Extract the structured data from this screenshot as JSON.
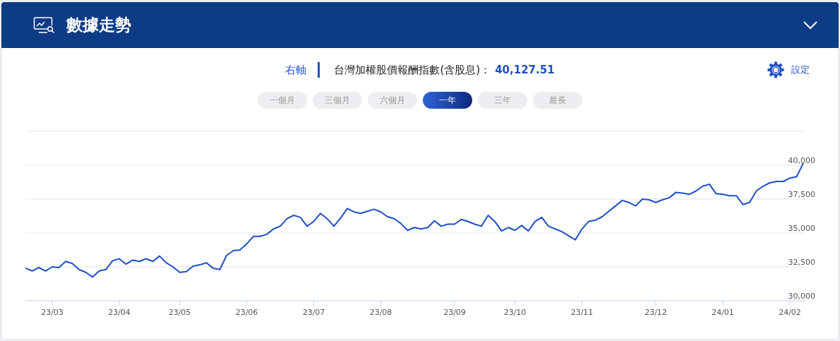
{
  "header": {
    "title": "數據走勢"
  },
  "info": {
    "axis_label": "右軸",
    "index_label": "台灣加權股價報酬指數(含股息)：",
    "index_value": "40,127.51",
    "settings_label": "設定"
  },
  "ranges": [
    {
      "label": "一個月",
      "selected": false
    },
    {
      "label": "三個月",
      "selected": false
    },
    {
      "label": "六個月",
      "selected": false
    },
    {
      "label": "一年",
      "selected": true
    },
    {
      "label": "三年",
      "selected": false
    },
    {
      "label": "最長",
      "selected": false
    }
  ],
  "chart": {
    "chart_data": {
      "type": "line",
      "grid": true,
      "ylim": [
        30000,
        42500
      ],
      "categories": [
        null,
        null,
        null,
        null,
        "23/03",
        null,
        null,
        null,
        null,
        null,
        null,
        null,
        null,
        null,
        "23/04",
        null,
        null,
        null,
        null,
        null,
        null,
        null,
        null,
        "23/05",
        null,
        null,
        null,
        null,
        null,
        null,
        null,
        null,
        null,
        "23/06",
        null,
        null,
        null,
        null,
        null,
        null,
        null,
        null,
        null,
        "23/07",
        null,
        null,
        null,
        null,
        null,
        null,
        null,
        null,
        null,
        "23/08",
        null,
        null,
        null,
        null,
        null,
        null,
        null,
        null,
        null,
        null,
        "23/09",
        null,
        null,
        null,
        null,
        null,
        null,
        null,
        null,
        "23/10",
        null,
        null,
        null,
        null,
        null,
        null,
        null,
        null,
        null,
        "23/11",
        null,
        null,
        null,
        null,
        null,
        null,
        null,
        null,
        null,
        null,
        "23/12",
        null,
        null,
        null,
        null,
        null,
        null,
        null,
        null,
        null,
        "24/01",
        null,
        null,
        null,
        null,
        null,
        null,
        null,
        null,
        null,
        "24/02",
        null,
        null
      ],
      "yticks": [
        {
          "value": 30000,
          "label": "30,000"
        },
        {
          "value": 32500,
          "label": "32,500"
        },
        {
          "value": 35000,
          "label": "35,000"
        },
        {
          "value": 37500,
          "label": "37,500"
        },
        {
          "value": 40000,
          "label": "40,000"
        }
      ],
      "series": [
        {
          "color": "#1f4fc4",
          "values": [
            32400,
            32200,
            32450,
            32200,
            32500,
            32450,
            32900,
            32750,
            32300,
            32100,
            31750,
            32200,
            32300,
            32950,
            33100,
            32700,
            33000,
            32900,
            33100,
            32900,
            33300,
            32800,
            32500,
            32100,
            32150,
            32550,
            32650,
            32800,
            32400,
            32300,
            33350,
            33700,
            33750,
            34200,
            34750,
            34750,
            34900,
            35300,
            35500,
            36050,
            36300,
            36150,
            35500,
            35850,
            36450,
            36050,
            35500,
            36100,
            36800,
            36550,
            36450,
            36600,
            36750,
            36550,
            36200,
            36050,
            35700,
            35200,
            35400,
            35300,
            35400,
            35900,
            35500,
            35650,
            35650,
            36000,
            35850,
            35650,
            35500,
            36300,
            35850,
            35150,
            35400,
            35200,
            35550,
            35150,
            35850,
            36150,
            35500,
            35300,
            35100,
            34800,
            34500,
            35300,
            35850,
            35950,
            36200,
            36600,
            37000,
            37400,
            37250,
            37000,
            37500,
            37450,
            37250,
            37450,
            37600,
            38000,
            37950,
            37850,
            38100,
            38450,
            38600,
            37900,
            37850,
            37750,
            37750,
            37100,
            37250,
            38100,
            38450,
            38700,
            38800,
            38800,
            39050,
            39150,
            40150
          ]
        }
      ]
    }
  }
}
